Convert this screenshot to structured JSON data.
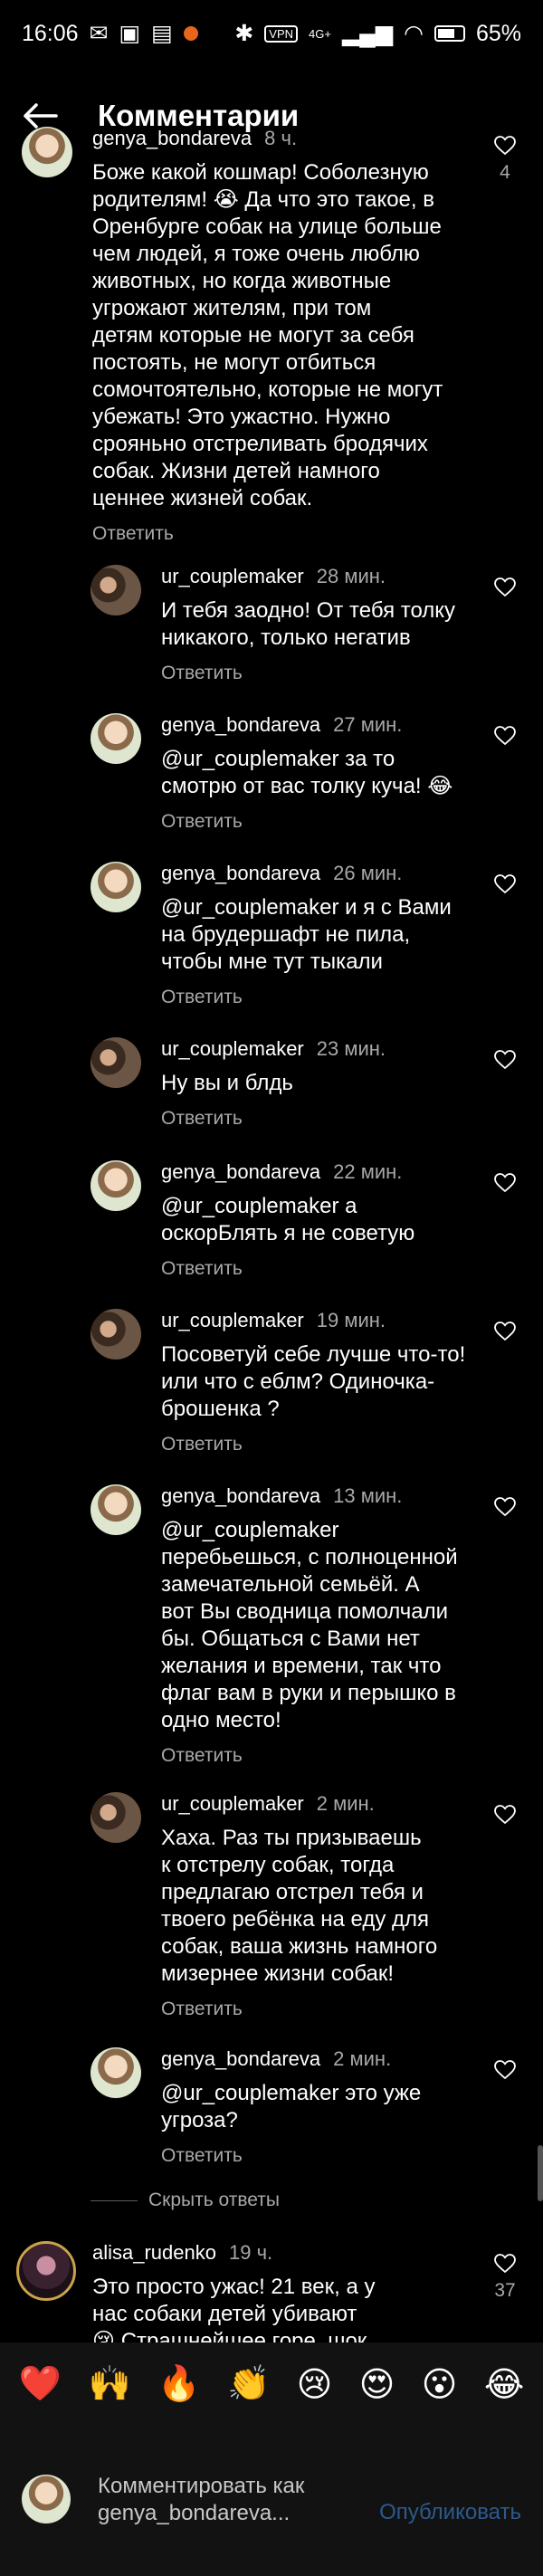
{
  "status_bar": {
    "time": "16:06",
    "vpn": "VPN",
    "network": "4G+",
    "battery": "65%",
    "colors": {
      "dot": "#e8651c"
    }
  },
  "header": {
    "title": "Комментарии",
    "back_icon": "arrow-left-icon"
  },
  "comments": [
    {
      "user": "genya_bondareva",
      "time": "8 ч.",
      "text": "Боже какой кошмар! Соболезную\nродителям! 😭 Да что это такое, в\nОренбурге собак на улице больше\nчем людей, я тоже очень люблю\nживотных, но когда животные\nугрожают жителям, при том\nдетям которые не могут за себя\nпостоять, не могут отбиться\nсомочтоятельно, которые не могут\nубежать! Это ужастно. Нужно\nсрояньно отстреливать бродячих\nсобак. Жизни детей намного\nценнее жизней собак.",
      "reply_label": "Ответить",
      "likes": "4"
    },
    {
      "user": "ur_couplemaker",
      "time": "28 мин.",
      "text": "И тебя заодно! От тебя толку\nникакого, только негатив",
      "reply_label": "Ответить"
    },
    {
      "user": "genya_bondareva",
      "time": "27 мин.",
      "text": "@ur_couplemaker за то\nсмотрю от вас толку куча! 😂",
      "reply_label": "Ответить"
    },
    {
      "user": "genya_bondareva",
      "time": "26 мин.",
      "text": "@ur_couplemaker и я с Вами\nна брудершафт не пила,\nчтобы мне тут тыкали",
      "reply_label": "Ответить"
    },
    {
      "user": "ur_couplemaker",
      "time": "23 мин.",
      "text": "Ну вы и блдь",
      "reply_label": "Ответить"
    },
    {
      "user": "genya_bondareva",
      "time": "22 мин.",
      "text": "@ur_couplemaker а\nоскорБлять я не советую",
      "reply_label": "Ответить"
    },
    {
      "user": "ur_couplemaker",
      "time": "19 мин.",
      "text": "Посоветуй себе лучше что-то!\nили что с еблм? Одиночка-\nброшенка ?",
      "reply_label": "Ответить"
    },
    {
      "user": "genya_bondareva",
      "time": "13 мин.",
      "text": "@ur_couplemaker\nперебьешься, с полноценной\nзамечательной семьёй. А\nвот Вы сводница помолчали\nбы. Общаться с Вами нет\nжелания и времени, так что\nфлаг вам в руки и перышко в\nодно место!",
      "reply_label": "Ответить"
    },
    {
      "user": "ur_couplemaker",
      "time": "2 мин.",
      "text": "Хаха. Раз ты призываешь\nк отстрелу собак, тогда\nпредлагаю отстрел тебя и\nтвоего ребёнка на еду для\nсобак, ваша жизнь намного\nмизернее жизни собак!",
      "reply_label": "Ответить"
    },
    {
      "user": "genya_bondareva",
      "time": "2 мин.",
      "text": "@ur_couplemaker это уже\nугроза?",
      "reply_label": "Ответить"
    },
    {
      "user": "alisa_rudenko",
      "time": "19 ч.",
      "text": "Это просто ужас! 21 век, а у\nнас собаки детей убивают\n😢 Страшнейшее горе, шок",
      "likes": "37"
    }
  ],
  "hide_replies": "Скрыть ответы",
  "emoji_bar": [
    "❤️",
    "🙌",
    "🔥",
    "👏",
    "😢",
    "😍",
    "😮",
    "😂"
  ],
  "composer": {
    "placeholder": "Комментировать как\ngenya_bondareva...",
    "publish": "Опубликовать"
  }
}
